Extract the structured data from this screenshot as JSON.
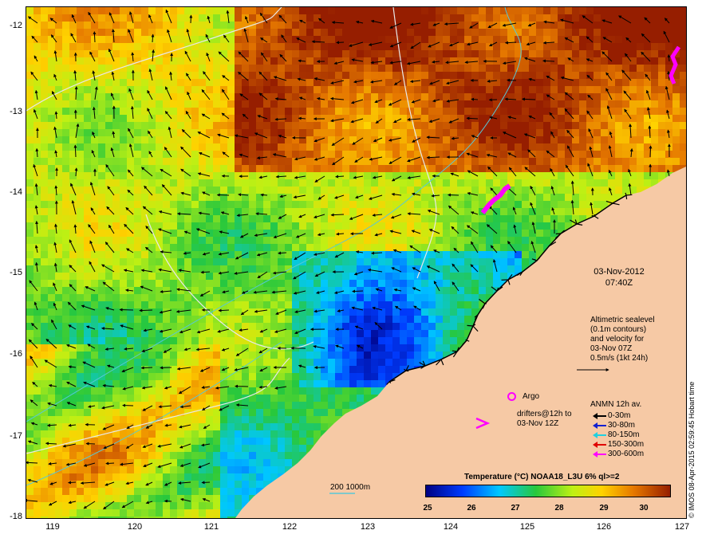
{
  "map": {
    "lat_ticks": [
      "-12",
      "-13",
      "-14",
      "-15",
      "-16",
      "-17",
      "-18"
    ],
    "lon_ticks": [
      "119",
      "120",
      "121",
      "122",
      "123",
      "124",
      "125",
      "126",
      "127"
    ],
    "land_color": "#f6c9a5",
    "coast_color": "#000000",
    "contour_color": "#e8e8e8",
    "isobath_color": "#58c8d8",
    "marker_color": "#ff00ff"
  },
  "datestamp": {
    "date": "03-Nov-2012",
    "time": "07:40Z"
  },
  "altimetry": {
    "line1": "Altimetric sealevel",
    "line2": "(0.1m contours)",
    "line3": "and velocity for",
    "line4": "03-Nov 07Z",
    "line5": "0.5m/s (1kt 24h)"
  },
  "argo": {
    "label": "Argo"
  },
  "drifters": {
    "line1": "drifters@12h to",
    "line2": "03-Nov 12Z"
  },
  "anmn": {
    "title": "ANMN 12h av.",
    "items": [
      {
        "label": "0-30m",
        "color": "#000000"
      },
      {
        "label": "30-80m",
        "color": "#1020d0"
      },
      {
        "label": "80-150m",
        "color": "#20d0e0"
      },
      {
        "label": "150-300m",
        "color": "#e00000"
      },
      {
        "label": "300-600m",
        "color": "#ff00ff"
      }
    ]
  },
  "colorbar": {
    "title": "Temperature (°C) NOAA18_L3U 6% ql>=2",
    "ticks": [
      "25",
      "26",
      "27",
      "28",
      "29",
      "30"
    ]
  },
  "scalebar": {
    "label": "200  1000m"
  },
  "credit": "© IMOS 08-Apr-2015 02:59:45 Hobart time"
}
